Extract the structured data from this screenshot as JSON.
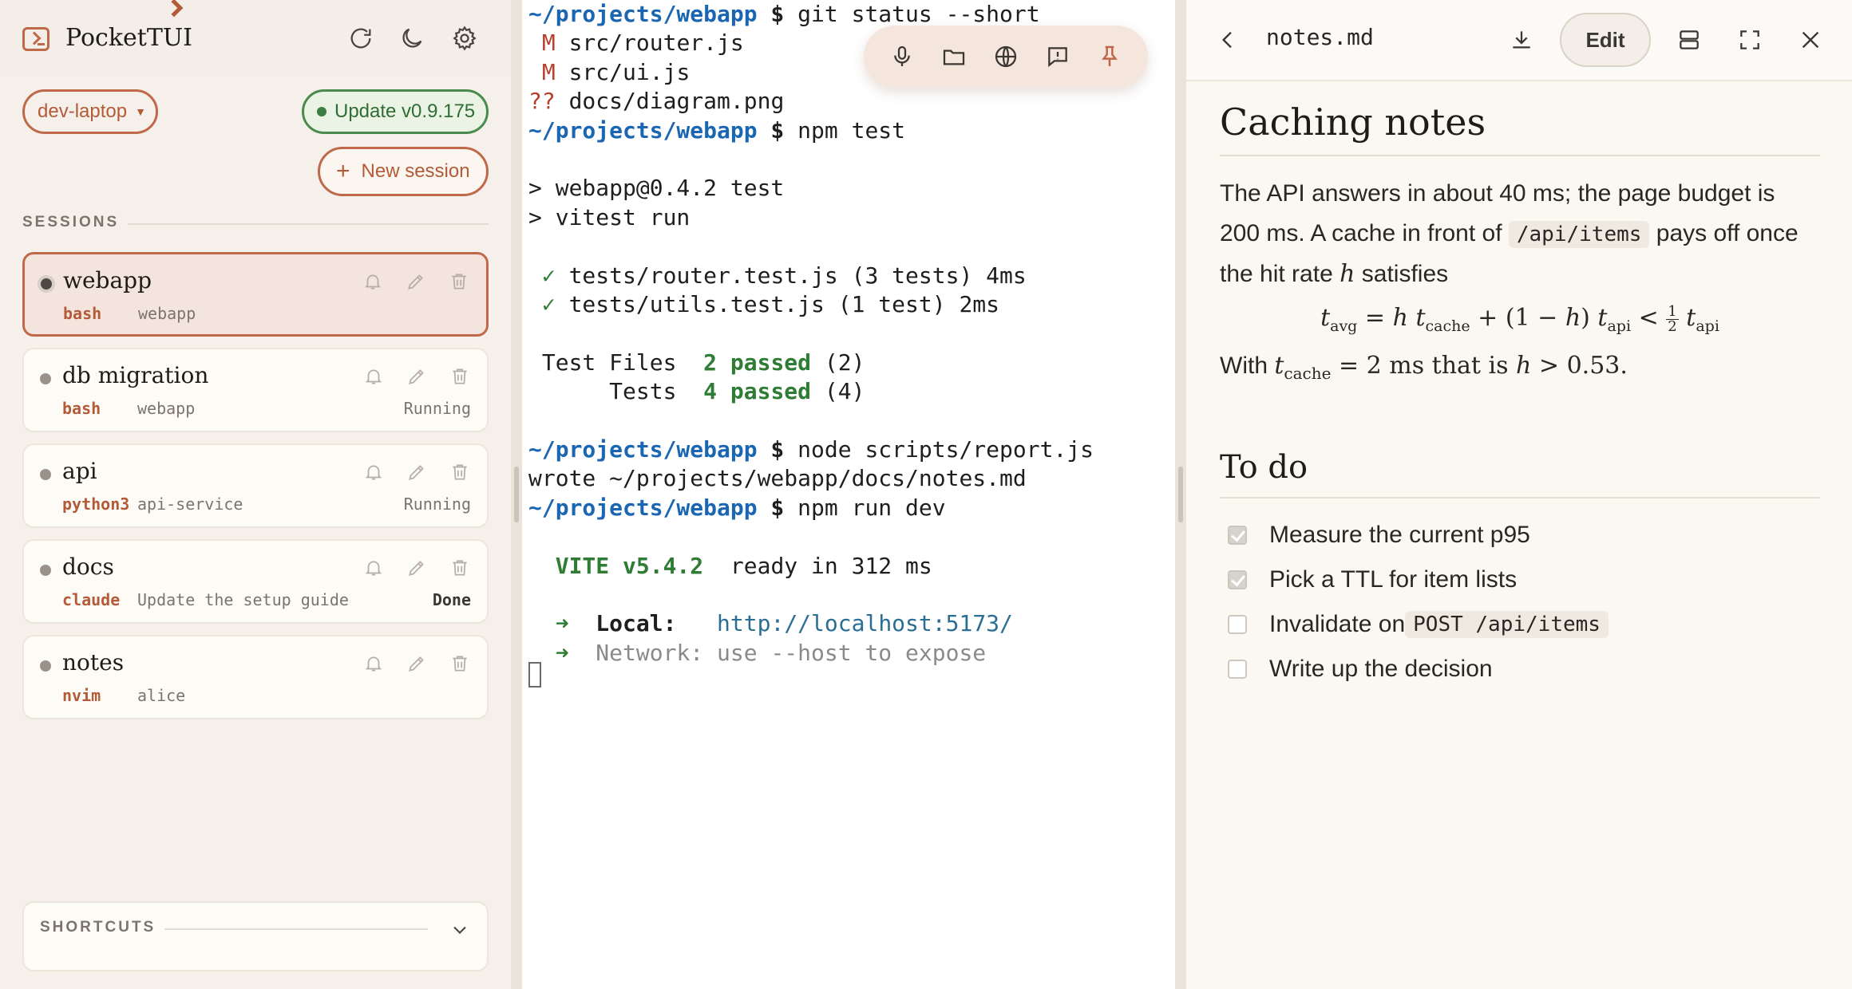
{
  "app": {
    "title": "PocketTUI",
    "host": "dev-laptop",
    "update_label": "Update v0.9.175",
    "new_session_label": "New session",
    "sessions_label": "SESSIONS",
    "shortcuts_label": "SHORTCUTS",
    "accent_color": "#c0694a"
  },
  "sessions": [
    {
      "name": "webapp",
      "shell": "bash",
      "dir": "webapp",
      "status": "",
      "active": true
    },
    {
      "name": "db migration",
      "shell": "bash",
      "dir": "webapp",
      "status": "Running",
      "active": false
    },
    {
      "name": "api",
      "shell": "python3",
      "dir": "api-service",
      "status": "Running",
      "active": false
    },
    {
      "name": "docs",
      "shell": "claude",
      "dir": "Update the setup guide",
      "status": "Done",
      "active": false
    },
    {
      "name": "notes",
      "shell": "nvim",
      "dir": "alice",
      "status": "",
      "active": false
    }
  ],
  "terminal": {
    "prompt": "~/projects/webapp",
    "lines": [
      {
        "t": "prompt",
        "cmd": "git status --short"
      },
      {
        "t": "status",
        "flag": "M",
        "file": "src/router.js"
      },
      {
        "t": "status",
        "flag": "M",
        "file": "src/ui.js"
      },
      {
        "t": "status",
        "flag": "??",
        "file": "docs/diagram.png"
      },
      {
        "t": "prompt",
        "cmd": "npm test"
      },
      {
        "t": "blank"
      },
      {
        "t": "text",
        "text": "> webapp@0.4.2 test"
      },
      {
        "t": "text",
        "text": "> vitest run"
      },
      {
        "t": "blank"
      },
      {
        "t": "check",
        "text": "tests/router.test.js (3 tests) 4ms"
      },
      {
        "t": "check",
        "text": "tests/utils.test.js (1 test) 2ms"
      },
      {
        "t": "blank"
      },
      {
        "t": "summary",
        "label": " Test Files  ",
        "value": "2 passed",
        "rest": " (2)"
      },
      {
        "t": "summary",
        "label": "      Tests  ",
        "value": "4 passed",
        "rest": " (4)"
      },
      {
        "t": "blank"
      },
      {
        "t": "prompt",
        "cmd": "node scripts/report.js"
      },
      {
        "t": "text",
        "text": "wrote ~/projects/webapp/docs/notes.md"
      },
      {
        "t": "prompt",
        "cmd": "npm run dev"
      },
      {
        "t": "blank"
      },
      {
        "t": "vite",
        "name": "VITE v5.4.2",
        "rest": "  ready in 312 ms"
      },
      {
        "t": "blank"
      },
      {
        "t": "local",
        "label": "Local:",
        "url": "http://localhost:5173/"
      },
      {
        "t": "network",
        "text": "Network: use --host to expose"
      }
    ],
    "toolbar_icons": [
      "microphone-icon",
      "folder-icon",
      "globe-icon",
      "feedback-icon",
      "pin-icon"
    ]
  },
  "viewer": {
    "filename": "notes.md",
    "edit_label": "Edit",
    "h1": "Caching notes",
    "p1_a": "The API answers in about 40 ms; the page budget is 200 ms. A cache in front of ",
    "p1_code": "/api/items",
    "p1_b": " pays off once the hit rate ",
    "p1_var": "h",
    "p1_c": " satisfies",
    "formula": {
      "lhs": "t",
      "lhs_sub": "avg",
      "h": "h",
      "t1": "t",
      "t1_sub": "cache",
      "mid": " + (1 − ",
      "mid2": ") ",
      "t2": "t",
      "t2_sub": "api",
      "lt": " < ",
      "frac_num": "1",
      "frac_den": "2",
      "t3": "t",
      "t3_sub": "api"
    },
    "p2_a": "With ",
    "p2_t": "t",
    "p2_sub": "cache",
    "p2_b": " = 2 ms that is ",
    "p2_h": "h",
    "p2_c": " > 0.53.",
    "h2": "To do",
    "todos": [
      {
        "label": "Measure the current p95",
        "checked": true
      },
      {
        "label": "Pick a TTL for item lists",
        "checked": true
      },
      {
        "label_a": "Invalidate on ",
        "code": "POST /api/items",
        "checked": false
      },
      {
        "label": "Write up the decision",
        "checked": false
      }
    ]
  }
}
